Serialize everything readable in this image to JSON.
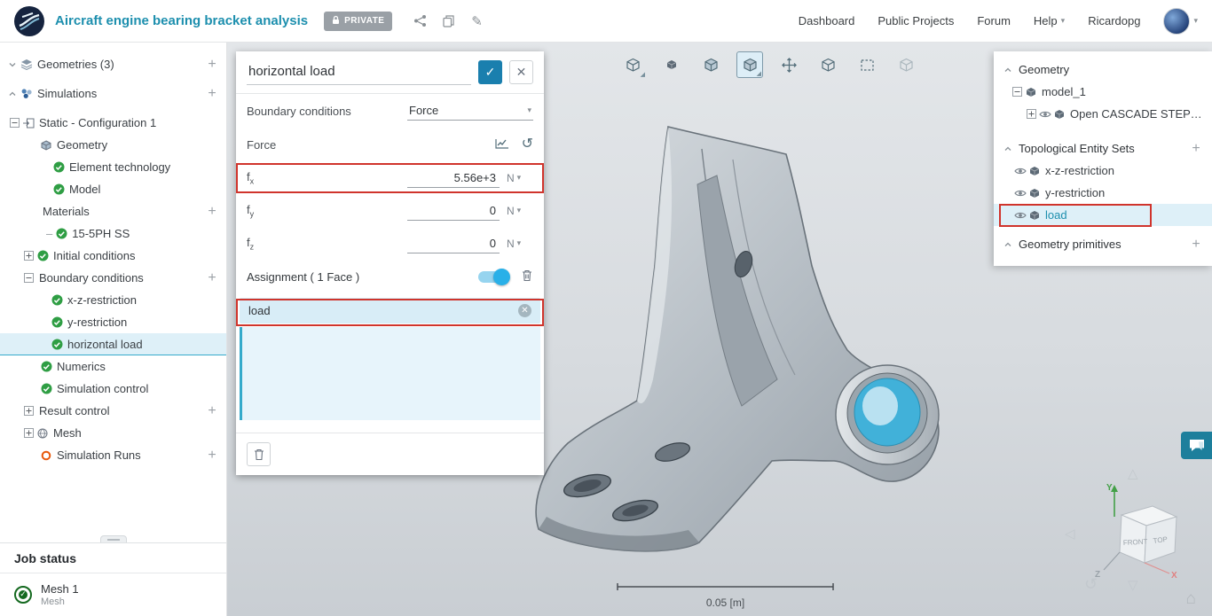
{
  "header": {
    "title": "Aircraft engine bearing bracket analysis",
    "private_badge": "PRIVATE",
    "nav_items": [
      {
        "label": "Dashboard",
        "name": "nav-dashboard"
      },
      {
        "label": "Public Projects",
        "name": "nav-public-projects"
      },
      {
        "label": "Forum",
        "name": "nav-forum"
      },
      {
        "label": "Help",
        "name": "nav-help",
        "caret": true
      },
      {
        "label": "Ricardopg",
        "name": "nav-username"
      }
    ]
  },
  "left_tree": [
    {
      "label": "Geometries (3)",
      "pad": 6,
      "caret": "down",
      "icon": "layers",
      "plus": true
    },
    {
      "label": "Simulations",
      "pad": 6,
      "caret": "up",
      "icon": "sims",
      "plus": true,
      "gap": true
    },
    {
      "label": "Static - Configuration 1",
      "pad": 8,
      "expander": "minus",
      "icon": "config",
      "gap": true
    },
    {
      "label": "Geometry",
      "pad": 44,
      "icon": "geomnode"
    },
    {
      "label": "Element technology",
      "pad": 58,
      "icon": "check"
    },
    {
      "label": "Model",
      "pad": 58,
      "icon": "check"
    },
    {
      "label": "Materials",
      "pad": 44,
      "plus": true
    },
    {
      "label": "15-5PH SS",
      "pad": 52,
      "dash": true,
      "icon": "check"
    },
    {
      "label": "Initial conditions",
      "pad": 24,
      "expander": "plus",
      "icon": "check"
    },
    {
      "label": "Boundary conditions",
      "pad": 24,
      "expander": "minus",
      "plus": true
    },
    {
      "label": "x-z-restriction",
      "pad": 56,
      "icon": "check"
    },
    {
      "label": "y-restriction",
      "pad": 56,
      "icon": "check"
    },
    {
      "label": "horizontal load",
      "pad": 56,
      "icon": "check",
      "selected": true
    },
    {
      "label": "Numerics",
      "pad": 44,
      "icon": "check"
    },
    {
      "label": "Simulation control",
      "pad": 44,
      "icon": "check"
    },
    {
      "label": "Result control",
      "pad": 24,
      "expander": "plus",
      "plus": true
    },
    {
      "label": "Mesh",
      "pad": 24,
      "expander": "plus",
      "icon": "meshball"
    },
    {
      "label": "Simulation Runs",
      "pad": 44,
      "icon": "run",
      "plus": true
    }
  ],
  "job_status": {
    "title": "Job status",
    "items": [
      {
        "name": "Mesh 1",
        "type": "Mesh",
        "status": "success"
      }
    ]
  },
  "panel": {
    "title_value": "horizontal load",
    "boundary_conditions_label": "Boundary conditions",
    "boundary_conditions_value": "Force",
    "force_section_label": "Force",
    "force_fields": [
      {
        "label": "f",
        "sub": "x",
        "value": "5.56e+3",
        "unit": "N"
      },
      {
        "label": "f",
        "sub": "y",
        "value": "0",
        "unit": "N"
      },
      {
        "label": "f",
        "sub": "z",
        "value": "0",
        "unit": "N"
      }
    ],
    "assignment_label": "Assignment ( 1 Face )",
    "assignment_chip": "load"
  },
  "right_panel": {
    "geometry_header": "Geometry",
    "model_label": "model_1",
    "model_child_label": "Open CASCADE STEP tr...",
    "topo_header": "Topological Entity Sets",
    "topo_items": [
      {
        "label": "x-z-restriction"
      },
      {
        "label": "y-restriction"
      },
      {
        "label": "load",
        "selected": true
      }
    ],
    "primitives_header": "Geometry primitives"
  },
  "viewport": {
    "toolbar_icons": [
      {
        "name": "isometric-view-icon",
        "glyph": "cube",
        "corner": true
      },
      {
        "name": "solid-render-icon",
        "glyph": "cube-solid"
      },
      {
        "name": "shaded-render-icon",
        "glyph": "cube-shaded"
      },
      {
        "name": "visibility-mode-icon",
        "glyph": "cube-shaded",
        "selected": true,
        "corner": true
      },
      {
        "name": "move-entities-icon",
        "glyph": "move"
      },
      {
        "name": "wireframe-render-icon",
        "glyph": "cube"
      },
      {
        "name": "box-select-icon",
        "glyph": "select-box"
      },
      {
        "name": "transform-icon",
        "glyph": "cube",
        "disabled": true
      }
    ],
    "scale_label": "0.05 [m]",
    "nav_cube": {
      "front_label": "FRONT",
      "top_label": "TOP",
      "axis_x": "X",
      "axis_y": "Y",
      "axis_z": "Z"
    }
  },
  "colors": {
    "accent_teal": "#1d8fae",
    "annotation_red": "#d0342c",
    "check_green": "#2f9e44",
    "toggle_blue": "#29b0e8",
    "selection_bg": "#def0f8",
    "highlight_face": "#41b1d9"
  }
}
